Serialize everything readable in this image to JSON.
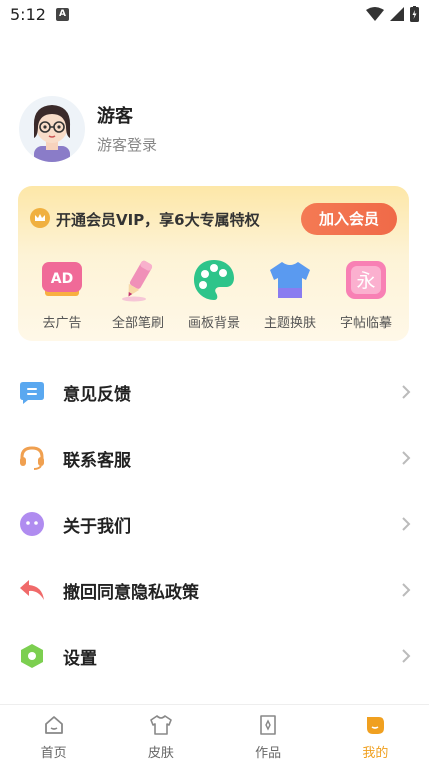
{
  "status_bar": {
    "time": "5:12",
    "notification_letter": "A"
  },
  "profile": {
    "name": "游客",
    "subtitle": "游客登录"
  },
  "vip": {
    "promo_text": "开通会员VIP，享6大专属特权",
    "join_button": "加入会员",
    "perks": [
      {
        "label": "去广告",
        "icon": "ad-icon"
      },
      {
        "label": "全部笔刷",
        "icon": "pencil-icon"
      },
      {
        "label": "画板背景",
        "icon": "palette-icon"
      },
      {
        "label": "主题换肤",
        "icon": "tshirt-icon"
      },
      {
        "label": "字帖临摹",
        "icon": "calligraphy-icon"
      }
    ],
    "ad_badge": "AD",
    "calligraphy_char": "永"
  },
  "menu": [
    {
      "label": "意见反馈",
      "icon": "feedback-icon",
      "color": "#5aa8f0"
    },
    {
      "label": "联系客服",
      "icon": "headset-icon",
      "color": "#f0a050"
    },
    {
      "label": "关于我们",
      "icon": "about-icon",
      "color": "#b08cf0"
    },
    {
      "label": "撤回同意隐私政策",
      "icon": "undo-icon",
      "color": "#f06a6a"
    },
    {
      "label": "设置",
      "icon": "settings-icon",
      "color": "#7ccf50"
    }
  ],
  "tabs": [
    {
      "label": "首页",
      "icon": "home-icon",
      "active": false
    },
    {
      "label": "皮肤",
      "icon": "shirt-icon",
      "active": false
    },
    {
      "label": "作品",
      "icon": "artwork-icon",
      "active": false
    },
    {
      "label": "我的",
      "icon": "me-icon",
      "active": true
    }
  ],
  "colors": {
    "accent": "#f0a020",
    "vip_button": "#f06a48"
  }
}
